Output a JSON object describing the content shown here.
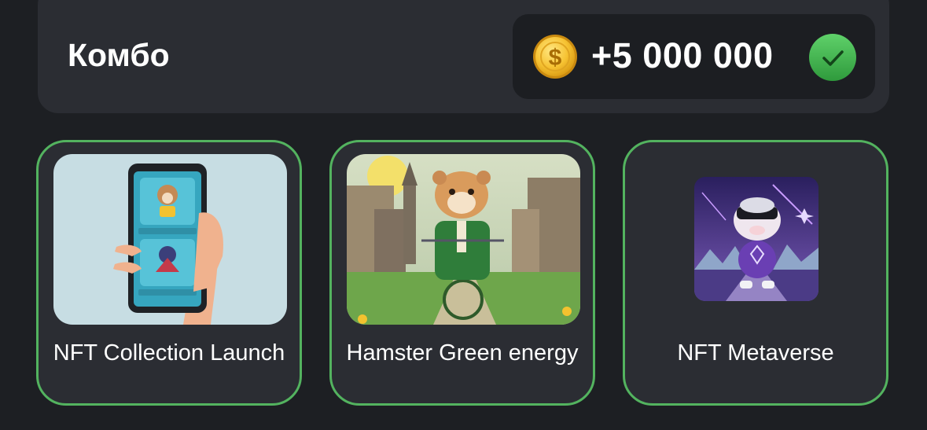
{
  "combo": {
    "title": "Комбо",
    "reward_amount": "+5 000 000",
    "coin_icon": "coin-dollar-icon",
    "status_icon": "checkmark-icon",
    "accent_color": "#53b35f"
  },
  "cards": [
    {
      "label": "NFT Collection Launch",
      "image": "phone-nft-collection-image",
      "selected": true
    },
    {
      "label": "Hamster Green energy",
      "image": "hamster-bicycle-image",
      "selected": true
    },
    {
      "label": "NFT Metaverse",
      "image": "hamster-vr-metaverse-image",
      "selected": true
    }
  ]
}
